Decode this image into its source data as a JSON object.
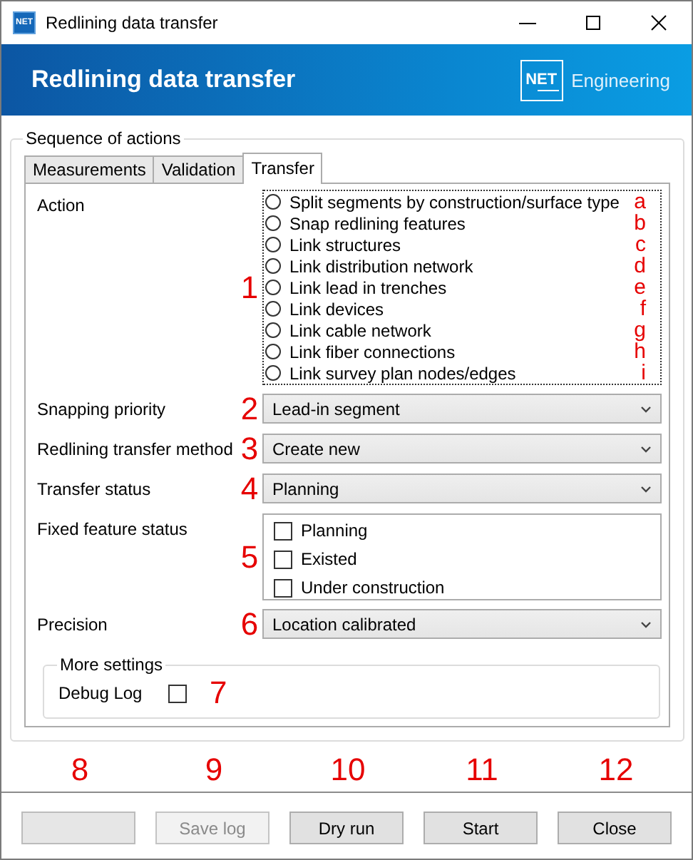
{
  "window": {
    "icon_text": "NET",
    "title": "Redlining data transfer"
  },
  "banner": {
    "title": "Redlining data transfer",
    "logo": "NET",
    "brand": "Engineering"
  },
  "group": {
    "title": "Sequence of actions"
  },
  "tabs": [
    {
      "label": "Measurements",
      "selected": false
    },
    {
      "label": "Validation",
      "selected": false
    },
    {
      "label": "Transfer",
      "selected": true
    }
  ],
  "action": {
    "label": "Action",
    "marker": "1",
    "options": [
      {
        "label": "Split segments by construction/surface type",
        "letter": "a",
        "selected": false
      },
      {
        "label": "Snap redlining features",
        "letter": "b",
        "selected": false
      },
      {
        "label": "Link structures",
        "letter": "c",
        "selected": false
      },
      {
        "label": "Link distribution network",
        "letter": "d",
        "selected": false
      },
      {
        "label": "Link lead in trenches",
        "letter": "e",
        "selected": false
      },
      {
        "label": "Link devices",
        "letter": "f",
        "selected": false
      },
      {
        "label": "Link cable network",
        "letter": "g",
        "selected": false
      },
      {
        "label": "Link fiber connections",
        "letter": "h",
        "selected": false
      },
      {
        "label": "Link survey plan nodes/edges",
        "letter": "i",
        "selected": false
      }
    ]
  },
  "settings": [
    {
      "kind": "dropdown",
      "label": "Snapping priority",
      "marker": "2",
      "value": "Lead-in segment"
    },
    {
      "kind": "dropdown",
      "label": "Redlining transfer method",
      "marker": "3",
      "value": "Create new"
    },
    {
      "kind": "dropdown",
      "label": "Transfer status",
      "marker": "4",
      "value": "Planning"
    },
    {
      "kind": "checklist",
      "label": "Fixed feature status",
      "marker": "5",
      "options": [
        {
          "label": "Planning",
          "checked": false
        },
        {
          "label": "Existed",
          "checked": false
        },
        {
          "label": "Under construction",
          "checked": false
        }
      ]
    },
    {
      "kind": "dropdown",
      "label": "Precision",
      "marker": "6",
      "value": "Location calibrated"
    }
  ],
  "more_settings": {
    "title": "More settings",
    "label": "Debug Log",
    "checked": false,
    "marker": "7"
  },
  "buttons": [
    {
      "marker": "8",
      "disabled": true
    },
    {
      "marker": "9",
      "label": "Save log",
      "disabled": true
    },
    {
      "marker": "10",
      "label": "Dry run",
      "disabled": false
    },
    {
      "marker": "11",
      "label": "Start",
      "disabled": false
    },
    {
      "marker": "12",
      "label": "Close",
      "disabled": false
    }
  ]
}
